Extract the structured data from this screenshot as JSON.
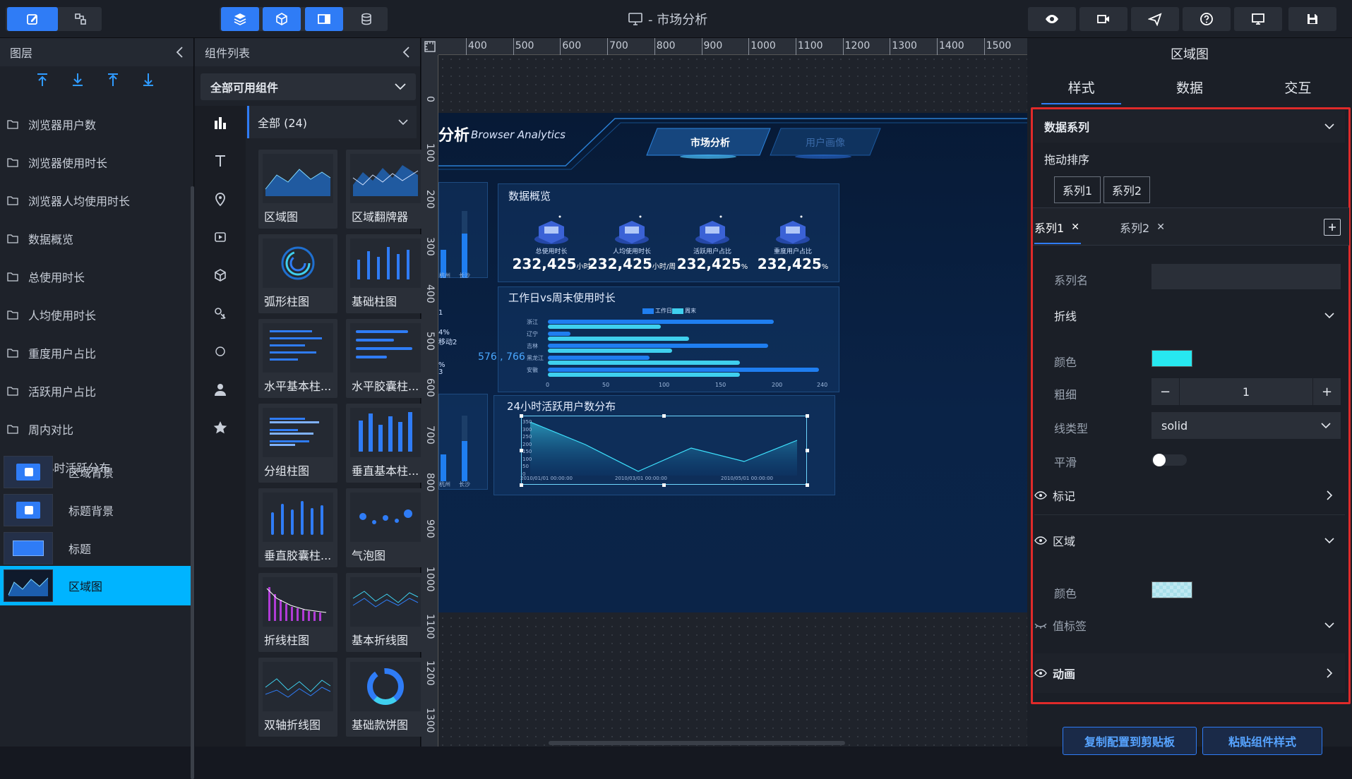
{
  "window": {
    "title": "- 市场分析"
  },
  "layers": {
    "header": "图层",
    "items": [
      "浏览器用户数",
      "浏览器使用时长",
      "浏览器人均使用时长",
      "数据概览",
      "总使用时长",
      "人均使用时长",
      "重度用户占比",
      "活跃用户占比",
      "周内对比",
      "24小时活跃分布"
    ],
    "thumb_items": [
      "区域背景",
      "标题背景",
      "标题",
      "区域图"
    ],
    "selected": "区域图"
  },
  "components": {
    "header": "组件列表",
    "select_value": "全部可用组件",
    "category": "全部 (24)",
    "cards": [
      "区域图",
      "区域翻牌器",
      "弧形柱图",
      "基础柱图",
      "水平基本柱...",
      "水平胶囊柱...",
      "分组柱图",
      "垂直基本柱...",
      "垂直胶囊柱...",
      "气泡图",
      "折线柱图",
      "基本折线图",
      "双轴折线图",
      "基础款饼图"
    ]
  },
  "canvas": {
    "ruler_h": [
      "400",
      "500",
      "600",
      "700",
      "800",
      "900",
      "1000",
      "1100",
      "1200",
      "1300",
      "1400",
      "1500"
    ],
    "ruler_v": [
      "0",
      "100",
      "200",
      "300",
      "400",
      "500",
      "600",
      "700",
      "800",
      "900",
      "1000",
      "1100",
      "1200",
      "1300"
    ],
    "coord_readout": "576 , 766",
    "screen": {
      "title_fragment": "分析",
      "subtitle": "Browser Analytics",
      "nav_active": "市场分析",
      "nav_other": "用户画像",
      "panel1_title": "数据概览",
      "stats": [
        {
          "value": "232,425",
          "unit": "小时",
          "label": "总使用时长"
        },
        {
          "value": "232,425",
          "unit": "小时/周",
          "label": "人均使用时长"
        },
        {
          "value": "232,425",
          "unit": "%",
          "label": "活跃用户占比"
        },
        {
          "value": "232,425",
          "unit": "%",
          "label": "重度用户占比"
        }
      ],
      "panel2_title": "工作日vs周末使用时长",
      "legend": [
        "工作日",
        "周末"
      ],
      "provinces": [
        "浙江",
        "辽宁",
        "吉林",
        "黑龙江",
        "安徽"
      ],
      "xticks": [
        "0",
        "50",
        "100",
        "150",
        "200",
        "240"
      ],
      "panel3_title": "24小时活跃用户数分布",
      "yticks": [
        "350",
        "300",
        "250",
        "200",
        "150",
        "100",
        "50",
        "0"
      ],
      "area_xlabels": [
        "2010/01/01 00:00:00",
        "2010/03/01 00:00:00",
        "2010/05/01 00:00:00"
      ],
      "left_labels": [
        "杭州",
        "长沙"
      ],
      "left_frag": [
        "4%",
        "移动2",
        "%",
        "3",
        "1"
      ]
    }
  },
  "props": {
    "header": "区域图",
    "tabs": [
      "样式",
      "数据",
      "交互"
    ],
    "active_tab": "样式",
    "data_series": "数据系列",
    "drag_sort": "拖动排序",
    "sort_chips": [
      "系列1",
      "系列2"
    ],
    "series_tabs": [
      "系列1",
      "系列2"
    ],
    "series_name_label": "系列名",
    "series_name_value": "",
    "line_section": "折线",
    "color_label": "颜色",
    "line_color": "#27e8f0",
    "width_label": "粗细",
    "width_value": "1",
    "linetype_label": "线类型",
    "linetype_value": "solid",
    "smooth_label": "平滑",
    "marker_label": "标记",
    "area_label": "区域",
    "area_color_label": "颜色",
    "value_label": "值标签",
    "animation_label": "动画",
    "copy_btn": "复制配置到剪贴板",
    "paste_btn": "粘贴组件样式"
  },
  "colors": {
    "accent": "#2f7cf6",
    "selected": "#00b4ff",
    "highlight_box": "#e02a2a"
  }
}
